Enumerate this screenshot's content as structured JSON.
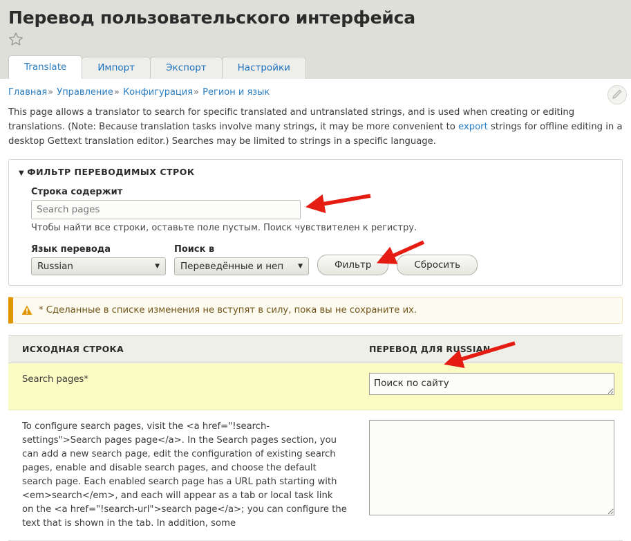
{
  "page": {
    "title": "Перевод пользовательского интерфейса",
    "star_icon": "star-outline-icon",
    "edit_icon": "pencil-edit-icon"
  },
  "tabs": [
    {
      "label": "Translate",
      "active": true
    },
    {
      "label": "Импорт",
      "active": false
    },
    {
      "label": "Экспорт",
      "active": false
    },
    {
      "label": "Настройки",
      "active": false
    }
  ],
  "breadcrumb": {
    "items": [
      "Главная",
      "Управление",
      "Конфигурация",
      "Регион и язык"
    ],
    "separator": "»"
  },
  "intro": {
    "part1": "This page allows a translator to search for specific translated and untranslated strings, and is used when creating or editing translations. (Note: Because translation tasks involve many strings, it may be more convenient to ",
    "link": "export",
    "part2": " strings for offline editing in a desktop Gettext translation editor.) Searches may be limited to strings in a specific language."
  },
  "filter": {
    "legend": "ФИЛЬТР ПЕРЕВОДИМЫХ СТРОК",
    "caret": "▼",
    "string_contains": {
      "label": "Строка содержит",
      "value": "Search pages",
      "placeholder": "Search pages",
      "help": "Чтобы найти все строки, оставьте поле пустым. Поиск чувствителен к регистру."
    },
    "language": {
      "label": "Язык перевода",
      "selected": "Russian",
      "options": [
        "Russian"
      ]
    },
    "search_in": {
      "label": "Поиск в",
      "selected": "Переведённые и неп",
      "options": [
        "Переведённые и неп"
      ]
    },
    "filter_button": "Фильтр",
    "reset_button": "Сбросить"
  },
  "warning": {
    "icon": "warning-triangle-icon",
    "message": "* Сделанные в списке изменения не вступят в силу, пока вы не сохраните их."
  },
  "table": {
    "headers": [
      "ИСХОДНАЯ СТРОКА",
      "ПЕРЕВОД ДЛЯ RUSSIAN"
    ],
    "rows": [
      {
        "source": "Search pages*",
        "translation": "Поиск по сайту",
        "highlighted": true
      },
      {
        "source": "To configure search pages, visit the <a href=\"!search-settings\">Search pages page</a>. In the Search pages section, you can add a new search page, edit the configuration of existing search pages, enable and disable search pages, and choose the default search page. Each enabled search page has a URL path starting with <em>search</em>, and each will appear as a tab or local task link on the <a href=\"!search-url\">search page</a>; you can configure the text that is shown in the tab. In addition, some",
        "translation": "",
        "highlighted": false
      }
    ]
  },
  "annotations": {
    "arrow_color": "#e51c12",
    "arrows": [
      {
        "name": "arrow-to-search-field",
        "points_at": "string-contains-input"
      },
      {
        "name": "arrow-to-filter-button",
        "points_at": "filter-button"
      },
      {
        "name": "arrow-to-translation-field",
        "points_at": "translation-textarea-row-1"
      }
    ]
  },
  "colors": {
    "header_bg": "#dedfd8",
    "accent_link": "#2a7ec2",
    "highlight_row": "#fbfbc4",
    "warning_border": "#e09600",
    "table_header_bg": "#eeefe8"
  }
}
